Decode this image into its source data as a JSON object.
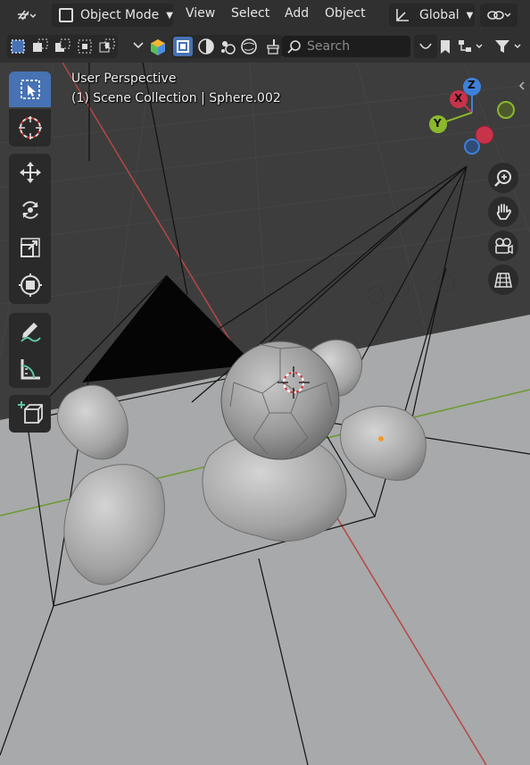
{
  "header": {
    "mode_label": "Object Mode",
    "menus": [
      "View",
      "Select",
      "Add",
      "Object"
    ],
    "transform_orientation": "Global",
    "search_placeholder": "Search"
  },
  "overlay": {
    "view_name": "User Perspective",
    "collection_info": "(1) Scene Collection | Sphere.002"
  },
  "gizmo": {
    "x_label": "X",
    "y_label": "Y",
    "z_label": "Z",
    "x_color": "#c7334b",
    "y_color": "#8bb82c",
    "z_color": "#3f81d9"
  },
  "toolbar": {
    "tools": [
      "select-box-icon",
      "cursor-icon",
      "move-icon",
      "rotate-icon",
      "scale-icon",
      "transform-icon",
      "annotate-icon",
      "measure-icon",
      "add-cube-icon"
    ],
    "active_tool": "select-box-icon"
  },
  "navigation": [
    "zoom-icon",
    "pan-hand-icon",
    "camera-view-icon",
    "ortho-grid-icon"
  ],
  "colors": {
    "viewport_bg": "#3d3d3d",
    "header_bg": "#303030",
    "accent": "#4772b3",
    "x_axis": "#b54747",
    "y_axis": "#6b9a2e",
    "floor": "#a8a9aa"
  }
}
